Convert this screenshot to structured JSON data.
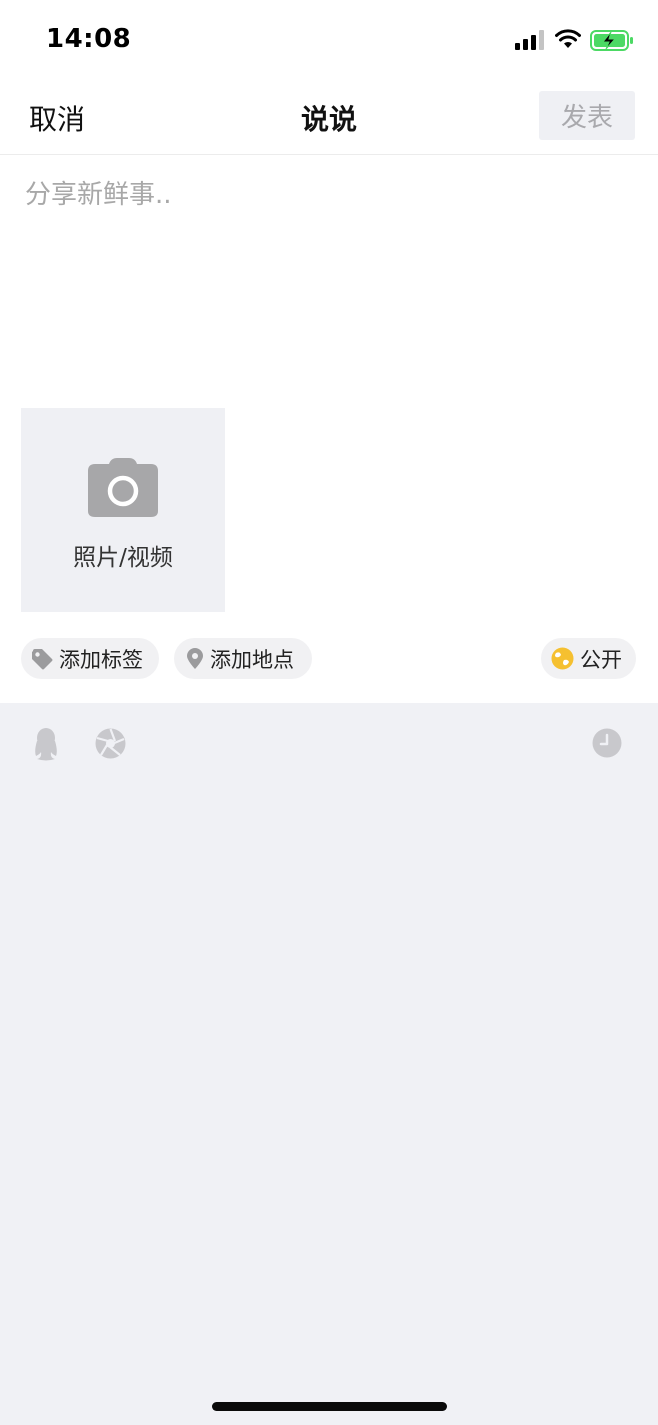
{
  "status_bar": {
    "time": "14:08",
    "icons": [
      "signal-icon",
      "wifi-icon",
      "battery-charging-icon"
    ]
  },
  "nav": {
    "cancel_label": "取消",
    "title": "说说",
    "publish_label": "发表"
  },
  "compose": {
    "placeholder": "分享新鲜事.."
  },
  "media": {
    "icon": "camera-icon",
    "label": "照片/视频"
  },
  "chips": {
    "tag_label": "添加标签",
    "location_label": "添加地点",
    "visibility_label": "公开"
  },
  "toolbar": {
    "icons": [
      "qq-icon",
      "aperture-icon",
      "clock-icon"
    ]
  },
  "colors": {
    "panel_bg": "#f0f1f5",
    "publish_bg": "#eff0f4",
    "visibility_accent": "#f5c030",
    "battery_green": "#4cd964"
  }
}
